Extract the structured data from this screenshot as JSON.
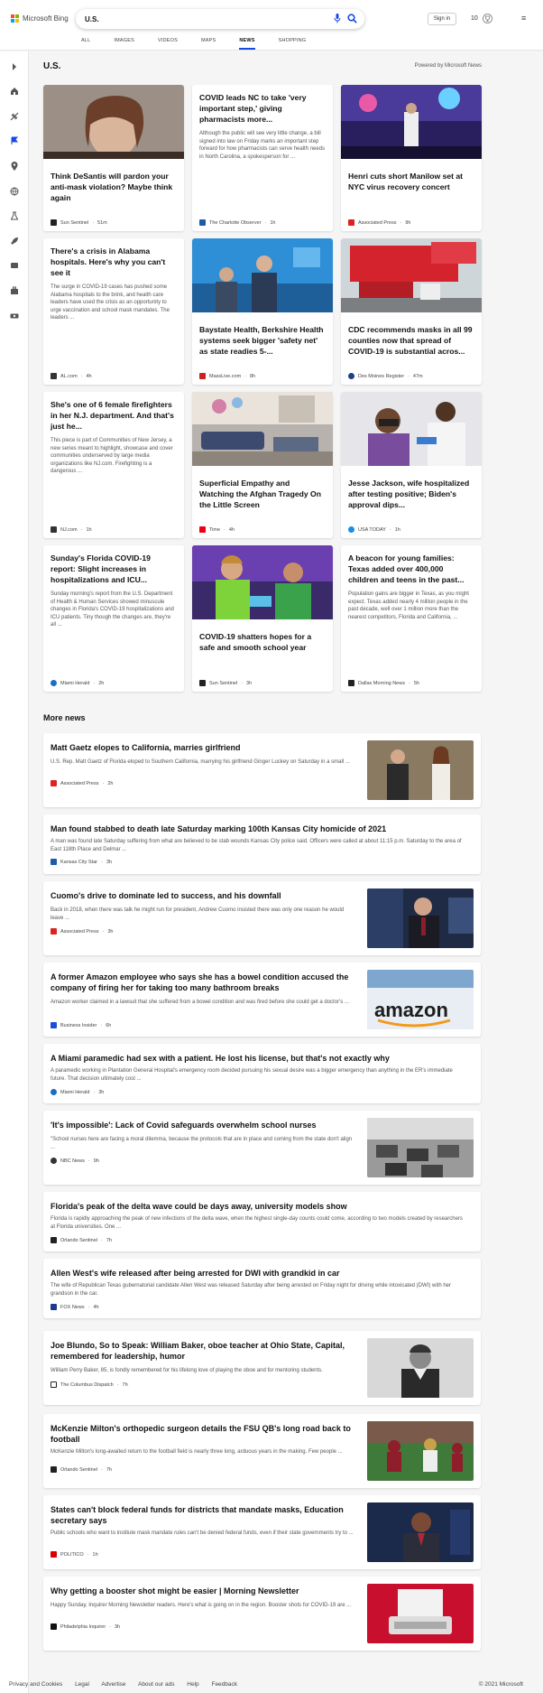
{
  "header": {
    "brand": "Microsoft Bing",
    "query": "U.S.",
    "signin": "Sign in",
    "points": "10",
    "tabs": [
      "ALL",
      "IMAGES",
      "VIDEOS",
      "MAPS",
      "NEWS",
      "SHOPPING"
    ],
    "active_tab": "NEWS"
  },
  "section": {
    "title": "U.S.",
    "powered": "Powered by Microsoft News"
  },
  "cards": [
    {
      "title": "Think DeSantis will pardon your anti-mask violation? Maybe think again",
      "desc": "",
      "source": "Sun Sentinel",
      "time": "51m",
      "src_color": "#222"
    },
    {
      "title": "COVID leads NC to take 'very important step,' giving pharmacists more...",
      "desc": "Although the public will see very little change, a bill signed into law on Friday marks an important step forward for how pharmacists can serve health needs in North Carolina, a spokesperson for ...",
      "source": "The Charlotte Observer",
      "time": "1h",
      "src_color": "#1d5ca8"
    },
    {
      "title": "Henri cuts short Manilow set at NYC virus recovery concert",
      "desc": "",
      "source": "Associated Press",
      "time": "9h",
      "src_color": "#d22"
    },
    {
      "title": "There's a crisis in Alabama hospitals. Here's why you can't see it",
      "desc": "The surge in COVID-19 cases has pushed some Alabama hospitals to the brink, and health care leaders have used the crisis as an opportunity to urge vaccination and school mask mandates. The leaders ...",
      "source": "AL.com",
      "time": "4h",
      "src_color": "#333"
    },
    {
      "title": "Baystate Health, Berkshire Health systems seek bigger 'safety net' as state readies 5-...",
      "desc": "",
      "source": "MassLive.com",
      "time": "8h",
      "src_color": "#c22"
    },
    {
      "title": "CDC recommends masks in all 99 counties now that spread of COVID-19 is substantial acros...",
      "desc": "",
      "source": "Des Moines Register",
      "time": "47m",
      "src_color": "#1d3f8a"
    },
    {
      "title": "She's one of 6 female firefighters in her N.J. department. And that's just he...",
      "desc": "This piece is part of Communities of New Jersey, a new series meant to highlight, showcase and cover communities underserved by large media organizations like NJ.com. Firefighting is a dangerous ...",
      "source": "NJ.com",
      "time": "1h",
      "src_color": "#333"
    },
    {
      "title": "Superficial Empathy and Watching the Afghan Tragedy On the Little Screen",
      "desc": "",
      "source": "Time",
      "time": "4h",
      "src_color": "#e01"
    },
    {
      "title": "Jesse Jackson, wife hospitalized after testing positive; Biden's approval dips...",
      "desc": "",
      "source": "USA TODAY",
      "time": "1h",
      "src_color": "#1a8fe0"
    },
    {
      "title": "Sunday's Florida COVID-19 report: Slight increases in hospitalizations and ICU...",
      "desc": "Sunday morning's report from the U.S. Department of Health & Human Services showed minuscule changes in Florida's COVID-19 hospitalizations and ICU patients. Tiny though the changes are, they're all ...",
      "source": "Miami Herald",
      "time": "2h",
      "src_color": "#1b6fc1"
    },
    {
      "title": "COVID-19 shatters hopes for a safe and smooth school year",
      "desc": "",
      "source": "Sun Sentinel",
      "time": "3h",
      "src_color": "#222"
    },
    {
      "title": "A beacon for young families: Texas added over 400,000 children and teens in the past...",
      "desc": "Population gains are bigger in Texas, as you might expect. Texas added nearly 4 million people in the past decade, well over 1 million more than the nearest competitors, Florida and California, ...",
      "source": "Dallas Morning News",
      "time": "5h",
      "src_color": "#222"
    }
  ],
  "more_news_title": "More news",
  "more_news": [
    {
      "title": "Matt Gaetz elopes to California, marries girlfriend",
      "desc": "U.S. Rep. Matt Gaetz of Florida eloped to Southern California, marrying his girlfriend Ginger Luckey on Saturday in a small ...",
      "source": "Associated Press",
      "time": "2h",
      "src_color": "#d22"
    },
    {
      "title": "Man found stabbed to death late Saturday marking 100th Kansas City homicide of 2021",
      "desc": "A man was found late Saturday suffering from what are believed to be stab wounds Kansas City police said. Officers were called at about 11:15 p.m. Saturday to the area of East 118th Place and Delmar ...",
      "source": "Kansas City Star",
      "time": "3h",
      "src_color": "#1d5ca8"
    },
    {
      "title": "Cuomo's drive to dominate led to success, and his downfall",
      "desc": "Back in 2018, when there was talk he might run for president, Andrew Cuomo insisted there was only one reason he would leave ...",
      "source": "Associated Press",
      "time": "3h",
      "src_color": "#d22"
    },
    {
      "title": "A former Amazon employee who says she has a bowel condition accused the company of firing her for taking too many bathroom breaks",
      "desc": "Amazon worker claimed in a lawsuit that she suffered from a bowel condition and was fired before she could get a doctor's ...",
      "source": "Business Insider",
      "time": "6h",
      "src_color": "#1b4fd8"
    },
    {
      "title": "A Miami paramedic had sex with a patient. He lost his license, but that's not exactly why",
      "desc": "A paramedic working in Plantation General Hospital's emergency room decided pursuing his sexual desire was a bigger emergency than anything in the ER's immediate future. That decision ultimately cost ...",
      "source": "Miami Herald",
      "time": "3h",
      "src_color": "#1b6fc1"
    },
    {
      "title": "'It's impossible': Lack of Covid safeguards overwhelm school nurses",
      "desc": "\"School nurses here are facing a moral dilemma, because the protocols that are in place and coming from the state don't align ...",
      "source": "NBC News",
      "time": "9h",
      "src_color": "#333"
    },
    {
      "title": "Florida's peak of the delta wave could be days away, university models show",
      "desc": "Florida is rapidly approaching the peak of new infections of the delta wave, when the highest single-day counts could come, according to two models created by researchers at Florida universities. One ...",
      "source": "Orlando Sentinel",
      "time": "7h",
      "src_color": "#222"
    },
    {
      "title": "Allen West's wife released after being arrested for DWI with grandkid in car",
      "desc": "The wife of Republican Texas gubernatorial candidate Allen West was released Saturday after being arrested on Friday night for driving while intoxicated (DWI) with her grandson in the car.",
      "source": "FOX News",
      "time": "4h",
      "src_color": "#1a3a8a"
    },
    {
      "title": "Joe Blundo, So to Speak: William Baker, oboe teacher at Ohio State, Capital, remembered for leadership, humor",
      "desc": "William Perry Baker, 85, is fondly remembered for his lifelong love of playing the oboe and for mentoring students.",
      "source": "The Columbus Dispatch",
      "time": "7h",
      "src_color": "#222"
    },
    {
      "title": "McKenzie Milton's orthopedic surgeon details the FSU QB's long road back to football",
      "desc": "McKenzie Milton's long-awaited return to the football field is nearly three long, arduous years in the making. Few people ...",
      "source": "Orlando Sentinel",
      "time": "7h",
      "src_color": "#222"
    },
    {
      "title": "States can't block federal funds for districts that mandate masks, Education secretary says",
      "desc": "Public schools who want to institute mask mandate rules can't be denied federal funds, even if their state governments try to ...",
      "source": "POLITICO",
      "time": "1h",
      "src_color": "#d00"
    },
    {
      "title": "Why getting a booster shot might be easier | Morning Newsletter",
      "desc": "Happy Sunday, Inquirer Morning Newsletter readers. Here's what is going on in the region. Booster shots for COVID-19 are ...",
      "source": "Philadelphia Inquirer",
      "time": "3h",
      "src_color": "#111"
    }
  ],
  "footer": {
    "links": [
      "Privacy and Cookies",
      "Legal",
      "Advertise",
      "About our ads",
      "Help",
      "Feedback"
    ],
    "copyright": "© 2021 Microsoft"
  }
}
